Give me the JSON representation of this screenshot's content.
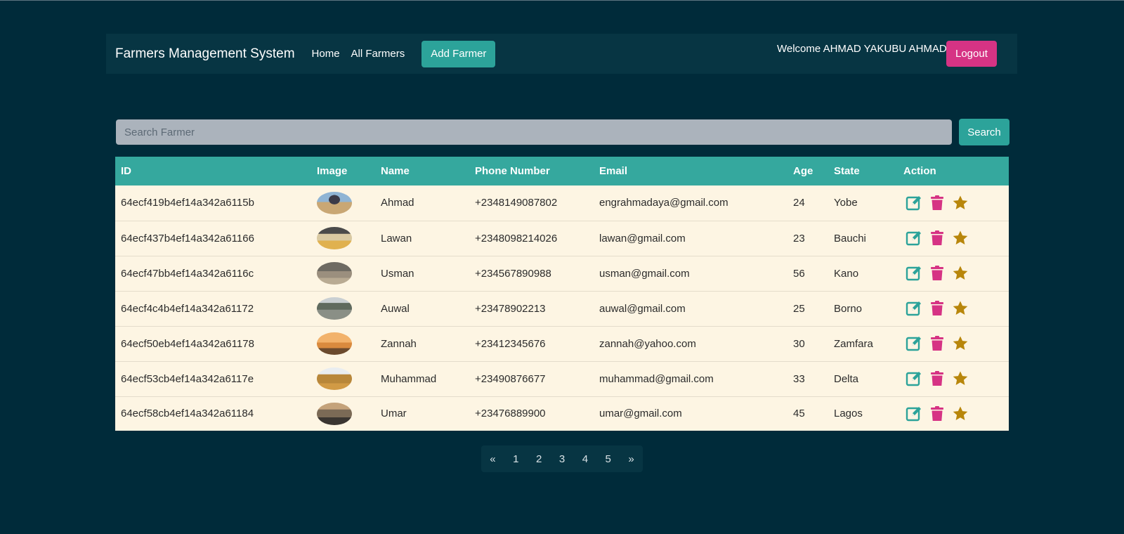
{
  "navbar": {
    "brand": "Farmers Management System",
    "links": [
      "Home",
      "All Farmers"
    ],
    "add_button": "Add Farmer",
    "welcome": "Welcome AHMAD YAKUBU AHMAD",
    "logout_button": "Logout"
  },
  "search": {
    "placeholder": "Search Farmer",
    "value": "",
    "button": "Search"
  },
  "table": {
    "columns": [
      "ID",
      "Image",
      "Name",
      "Phone Number",
      "Email",
      "Age",
      "State",
      "Action"
    ],
    "rows": [
      {
        "id": "64ecf419b4ef14a342a6115b",
        "name": "Ahmad",
        "phone": "+2348149087802",
        "email": "engrahmadaya@gmail.com",
        "age": "24",
        "state": "Yobe"
      },
      {
        "id": "64ecf437b4ef14a342a61166",
        "name": "Lawan",
        "phone": "+2348098214026",
        "email": "lawan@gmail.com",
        "age": "23",
        "state": "Bauchi"
      },
      {
        "id": "64ecf47bb4ef14a342a6116c",
        "name": "Usman",
        "phone": "+234567890988",
        "email": "usman@gmail.com",
        "age": "56",
        "state": "Kano"
      },
      {
        "id": "64ecf4c4b4ef14a342a61172",
        "name": "Auwal",
        "phone": "+23478902213",
        "email": "auwal@gmail.com",
        "age": "25",
        "state": "Borno"
      },
      {
        "id": "64ecf50eb4ef14a342a61178",
        "name": "Zannah",
        "phone": "+23412345676",
        "email": "zannah@yahoo.com",
        "age": "30",
        "state": "Zamfara"
      },
      {
        "id": "64ecf53cb4ef14a342a6117e",
        "name": "Muhammad",
        "phone": "+23490876677",
        "email": "muhammad@gmail.com",
        "age": "33",
        "state": "Delta"
      },
      {
        "id": "64ecf58cb4ef14a342a61184",
        "name": "Umar",
        "phone": "+23476889900",
        "email": "umar@gmail.com",
        "age": "45",
        "state": "Lagos"
      }
    ],
    "row_actions": [
      "edit-icon",
      "trash-icon",
      "star-icon"
    ]
  },
  "pagination": [
    "«",
    "1",
    "2",
    "3",
    "4",
    "5",
    "»"
  ],
  "colors": {
    "background": "#002b3a",
    "navbar": "#073543",
    "accent_teal": "#2ca39a",
    "logout_pink": "#d63384",
    "delete_pink": "#d63384",
    "star_gold": "#b8860b",
    "row_bg": "#fdf5e3"
  }
}
